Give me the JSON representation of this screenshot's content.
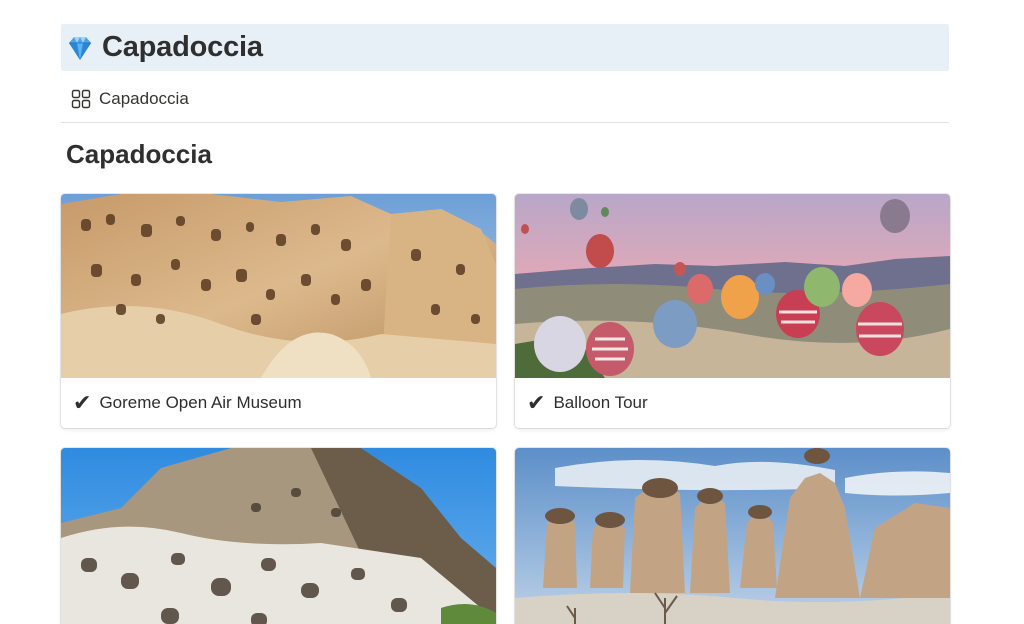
{
  "header": {
    "icon": "gem-icon",
    "title": "Capadoccia"
  },
  "view_tab": {
    "icon": "gallery-grid-icon",
    "label": "Capadoccia"
  },
  "section": {
    "title": "Capadoccia"
  },
  "gallery": {
    "cards": [
      {
        "check": "✔",
        "label": "Goreme Open Air Museum",
        "image": "cave-dwellings-photo"
      },
      {
        "check": "✔",
        "label": "Balloon Tour",
        "image": "hot-air-balloons-photo"
      },
      {
        "image": "rock-cave-town-photo"
      },
      {
        "image": "fairy-chimneys-photo"
      }
    ]
  },
  "colors": {
    "banner": "#e8f0f7",
    "text": "#2f2f2f",
    "divider": "#e3e2e0"
  }
}
